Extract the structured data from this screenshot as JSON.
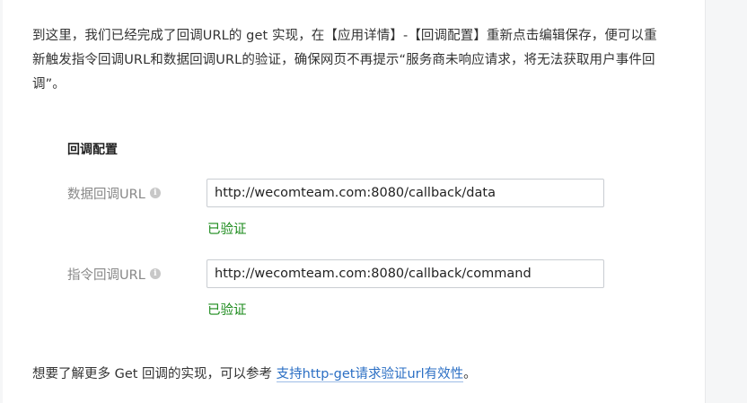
{
  "intro": {
    "line1": "到这里，我们已经完成了回调URL的 get 实现，在【应用详情】-【回调配置】重新点击编辑保存，便可以重",
    "line2": "新触发指令回调URL和数据回调URL的验证，确保网页不再提示“服务商未响应请求，将无法获取用户事件回",
    "line3": "调”。"
  },
  "config": {
    "title": "回调配置",
    "fields": [
      {
        "label": "数据回调URL",
        "value": "http://wecomteam.com:8080/callback/data",
        "status": "已验证"
      },
      {
        "label": "指令回调URL",
        "value": "http://wecomteam.com:8080/callback/command",
        "status": "已验证"
      }
    ]
  },
  "footer": {
    "prefix": "想要了解更多 Get 回调的实现，可以参考 ",
    "link_text": "支持http-get请求验证url有效性",
    "suffix": "。"
  },
  "icons": {
    "info_glyph": "i"
  },
  "colors": {
    "verified": "#1a8a1a",
    "link": "#2b6fc4",
    "label": "#888888"
  }
}
